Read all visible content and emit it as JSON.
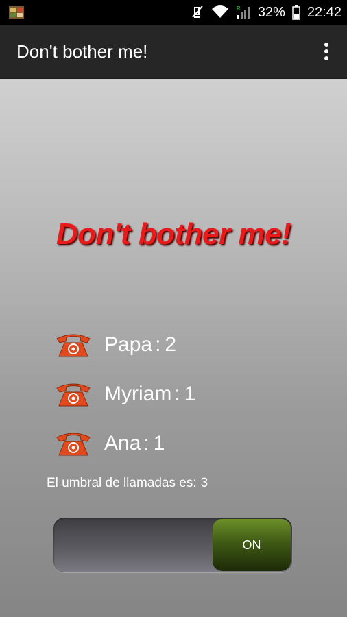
{
  "status_bar": {
    "battery": "32%",
    "time": "22:42",
    "icons": [
      "app-notification-icon",
      "mute-icon",
      "wifi-icon",
      "signal-icon",
      "battery-icon"
    ]
  },
  "app_bar": {
    "title": "Don't bother me!",
    "menu_icon": "overflow-menu-icon"
  },
  "main": {
    "headline": "Don't bother me!",
    "callers": [
      {
        "name": "Papa",
        "separator": ":",
        "count": "2"
      },
      {
        "name": "Myriam",
        "separator": ":",
        "count": "1"
      },
      {
        "name": "Ana",
        "separator": ":",
        "count": "1"
      }
    ],
    "threshold_label": "El umbral de llamadas es:",
    "threshold_value": "3",
    "toggle_label": "ON",
    "toggle_state": "on"
  },
  "colors": {
    "headline": "#e81a1a",
    "toggle_on": "#4f6e1a",
    "phone_icon": "#e04a1e"
  }
}
